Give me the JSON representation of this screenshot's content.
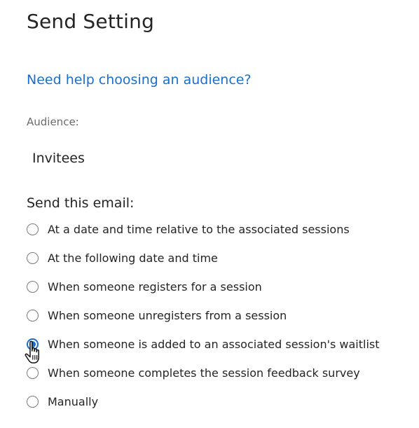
{
  "header": {
    "title": "Send Setting"
  },
  "help": {
    "link_text": "Need help choosing an audience?"
  },
  "audience": {
    "label": "Audience:",
    "value": "Invitees"
  },
  "send": {
    "label": "Send this email:",
    "options": [
      {
        "label": "At a date and time relative to the associated sessions",
        "checked": false
      },
      {
        "label": "At the following date and time",
        "checked": false
      },
      {
        "label": "When someone registers for a session",
        "checked": false
      },
      {
        "label": "When someone unregisters from a session",
        "checked": false
      },
      {
        "label": "When someone is added to an associated session's waitlist",
        "checked": true
      },
      {
        "label": "When someone completes the session feedback survey",
        "checked": false
      },
      {
        "label": "Manually",
        "checked": false
      }
    ]
  },
  "colors": {
    "accent": "#1a6fce",
    "text": "#242424",
    "muted": "#6b6b6b"
  },
  "icons": {
    "cursor": "hand-pointer-icon"
  }
}
